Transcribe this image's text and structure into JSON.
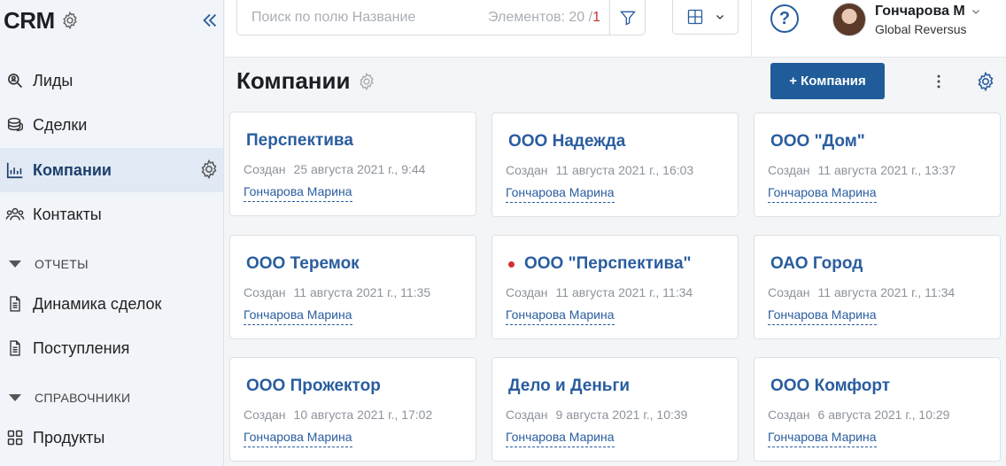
{
  "app": {
    "title": "CRM"
  },
  "sidebar": {
    "items": [
      {
        "label": "Лиды",
        "icon": "search-user-icon"
      },
      {
        "label": "Сделки",
        "icon": "coins-icon"
      },
      {
        "label": "Компании",
        "icon": "chart-icon",
        "active": true
      },
      {
        "label": "Контакты",
        "icon": "contacts-icon"
      }
    ],
    "section_reports": "ОТЧЕТЫ",
    "reports": [
      {
        "label": "Динамика сделок",
        "icon": "document-icon"
      },
      {
        "label": "Поступления",
        "icon": "document-icon"
      }
    ],
    "section_directories": "СПРАВОЧНИКИ",
    "directories": [
      {
        "label": "Продукты",
        "icon": "grid-icon"
      }
    ]
  },
  "search": {
    "placeholder": "Поиск по полю Название",
    "count_label": "Элементов: 20 /",
    "count_extra": "1"
  },
  "user": {
    "name": "Гончарова М",
    "org": "Global Reversus"
  },
  "page": {
    "title": "Компании",
    "add_button": "+ Компания"
  },
  "cards": [
    {
      "name": "Перспектива",
      "created_label": "Создан",
      "created": "25 августа 2021 г., 9:44",
      "author": "Гончарова Марина",
      "flag": false
    },
    {
      "name": "ООО Надежда",
      "created_label": "Создан",
      "created": "11 августа 2021 г., 16:03",
      "author": "Гончарова Марина",
      "flag": false
    },
    {
      "name": "ООО \"Дом\"",
      "created_label": "Создан",
      "created": "11 августа 2021 г., 13:37",
      "author": "Гончарова Марина",
      "flag": false
    },
    {
      "name": "ООО Теремок",
      "created_label": "Создан",
      "created": "11 августа 2021 г., 11:35",
      "author": "Гончарова Марина",
      "flag": false
    },
    {
      "name": "ООО \"Перспектива\"",
      "created_label": "Создан",
      "created": "11 августа 2021 г., 11:34",
      "author": "Гончарова Марина",
      "flag": true
    },
    {
      "name": "ОАО Город",
      "created_label": "Создан",
      "created": "11 августа 2021 г., 11:34",
      "author": "Гончарова Марина",
      "flag": false
    },
    {
      "name": "ООО Прожектор",
      "created_label": "Создан",
      "created": "10 августа 2021 г., 17:02",
      "author": "Гончарова Марина",
      "flag": false
    },
    {
      "name": "Дело и Деньги",
      "created_label": "Создан",
      "created": "9 августа 2021 г., 10:39",
      "author": "Гончарова Марина",
      "flag": false
    },
    {
      "name": "ООО Комфорт",
      "created_label": "Создан",
      "created": "6 августа 2021 г., 10:29",
      "author": "Гончарова Марина",
      "flag": false
    }
  ],
  "colors": {
    "accent": "#2a5d9f",
    "button": "#1f5c99",
    "flag": "#d23030",
    "active_bg": "#e0e9f4"
  }
}
